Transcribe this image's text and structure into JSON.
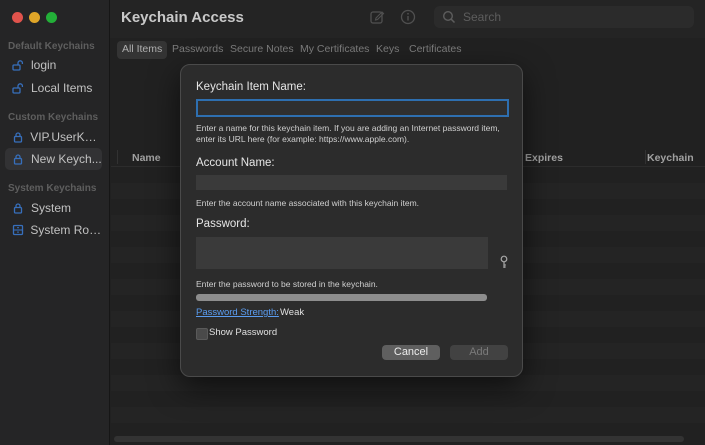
{
  "sidebar": {
    "sections": [
      {
        "label": "Default Keychains"
      },
      {
        "label": "Custom Keychains"
      },
      {
        "label": "System Keychains"
      }
    ],
    "items": [
      {
        "label": "login"
      },
      {
        "label": "Local Items"
      },
      {
        "label": "VIP.UserKey..."
      },
      {
        "label": "New Keych..."
      },
      {
        "label": "System"
      },
      {
        "label": "System Roots"
      }
    ]
  },
  "toolbar": {
    "title": "Keychain Access",
    "search_placeholder": "Search"
  },
  "tabs": [
    {
      "label": "All Items"
    },
    {
      "label": "Passwords"
    },
    {
      "label": "Secure Notes"
    },
    {
      "label": "My Certificates"
    },
    {
      "label": "Keys"
    },
    {
      "label": "Certificates"
    }
  ],
  "table": {
    "columns": [
      "Name",
      "Expires",
      "Keychain"
    ]
  },
  "dialog": {
    "item_name_label": "Keychain Item Name:",
    "item_name_help": "Enter a name for this keychain item. If you are adding an Internet password item, enter its URL here (for example: https://www.apple.com).",
    "item_name_value": "",
    "account_label": "Account Name:",
    "account_help": "Enter the account name associated with this keychain item.",
    "account_value": "",
    "password_label": "Password:",
    "password_help": "Enter the password to be stored in the keychain.",
    "password_value": "",
    "strength_link": "Password Strength:",
    "strength_value": "Weak",
    "show_password_label": "Show Password",
    "cancel_label": "Cancel",
    "add_label": "Add"
  },
  "colors": {
    "accent_focus": "#2e6fb0",
    "link": "#5a9cf0"
  }
}
